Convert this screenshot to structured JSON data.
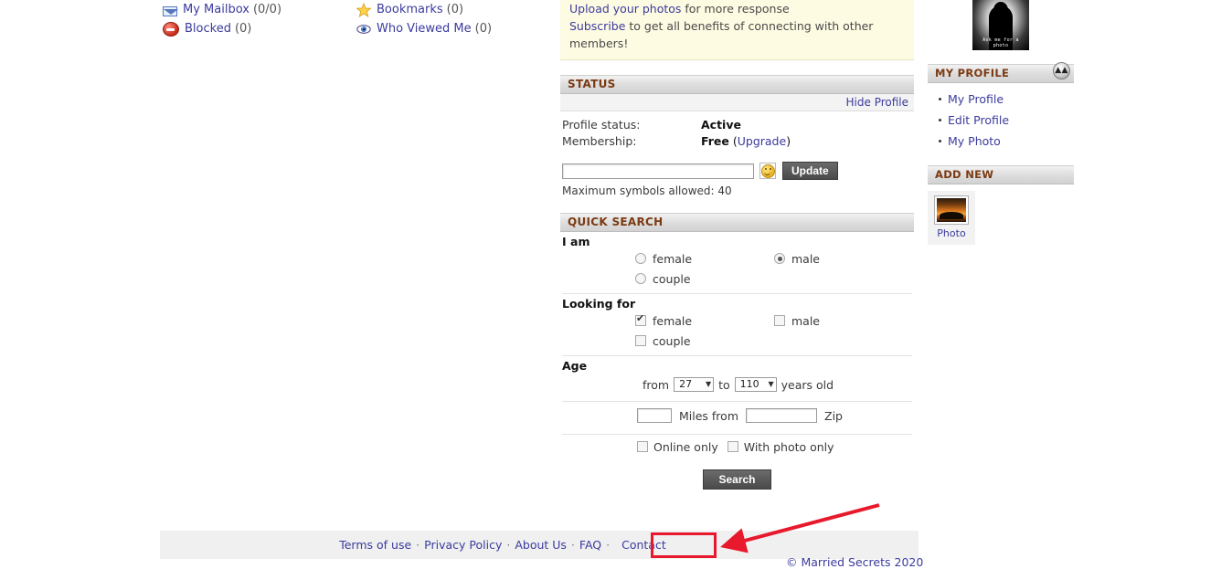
{
  "quick_links": [
    {
      "icon": "envelope-icon",
      "label": "My Mailbox",
      "count": "(0/0)"
    },
    {
      "icon": "star-icon",
      "label": "Bookmarks",
      "count": "(0)"
    },
    {
      "icon": "blocked-icon",
      "label": "Blocked",
      "count": "(0)"
    },
    {
      "icon": "eye-icon",
      "label": "Who Viewed Me",
      "count": "(0)"
    }
  ],
  "notice": {
    "line1_link": "Upload your photos",
    "line1_rest": " for more response",
    "line2_link": "Subscribe",
    "line2_rest": " to get all benefits of connecting with other members!"
  },
  "status": {
    "panel_title": "STATUS",
    "hide_profile": "Hide Profile",
    "profile_status_label": "Profile status:",
    "profile_status_value": "Active",
    "membership_label": "Membership:",
    "membership_value": "Free",
    "upgrade_open": "(",
    "upgrade_link": "Upgrade",
    "upgrade_close": ")",
    "status_input_value": "",
    "status_input_placeholder": "",
    "smiley_icon": "smiley-icon",
    "update_button": "Update",
    "max_symbols": "Maximum symbols allowed: 40"
  },
  "quick_search": {
    "panel_title": "QUICK SEARCH",
    "i_am_label": "I am",
    "i_am_options": [
      {
        "label": "female",
        "selected": false
      },
      {
        "label": "male",
        "selected": true
      },
      {
        "label": "couple",
        "selected": false
      }
    ],
    "looking_for_label": "Looking for",
    "looking_for_options": [
      {
        "label": "female",
        "checked": true
      },
      {
        "label": "male",
        "checked": false
      },
      {
        "label": "couple",
        "checked": false
      }
    ],
    "age_label": "Age",
    "age_from_word": "from",
    "age_from_value": "27",
    "age_to_word": "to",
    "age_to_value": "110",
    "age_suffix": "years old",
    "miles_value": "",
    "miles_label": "Miles from",
    "zip_value": "",
    "zip_label": "Zip",
    "online_only_label": "Online only",
    "online_only_checked": false,
    "with_photo_only_label": "With photo only",
    "with_photo_only_checked": false,
    "search_button": "Search"
  },
  "sidebar": {
    "avatar_caption_line1": "Ask me for a",
    "avatar_caption_line2": "photo",
    "my_profile_title": "MY PROFILE",
    "collapse_icon": "collapse-up-icon",
    "my_profile_items": [
      {
        "label": "My Profile"
      },
      {
        "label": "Edit Profile"
      },
      {
        "label": "My Photo"
      }
    ],
    "add_new_title": "ADD NEW",
    "add_new_items": [
      {
        "icon": "photo-thumbnail-icon",
        "label": "Photo"
      }
    ]
  },
  "footer": {
    "links": [
      {
        "label": "Terms of use"
      },
      {
        "label": "Privacy Policy"
      },
      {
        "label": "About Us"
      },
      {
        "label": "FAQ"
      },
      {
        "label": "Contact"
      }
    ],
    "separator": "·",
    "copyright": "© Married Secrets 2020"
  },
  "annotation": {
    "highlight_target": "Contact",
    "highlight_color": "#e8192c",
    "arrow_color": "#e8192c"
  }
}
